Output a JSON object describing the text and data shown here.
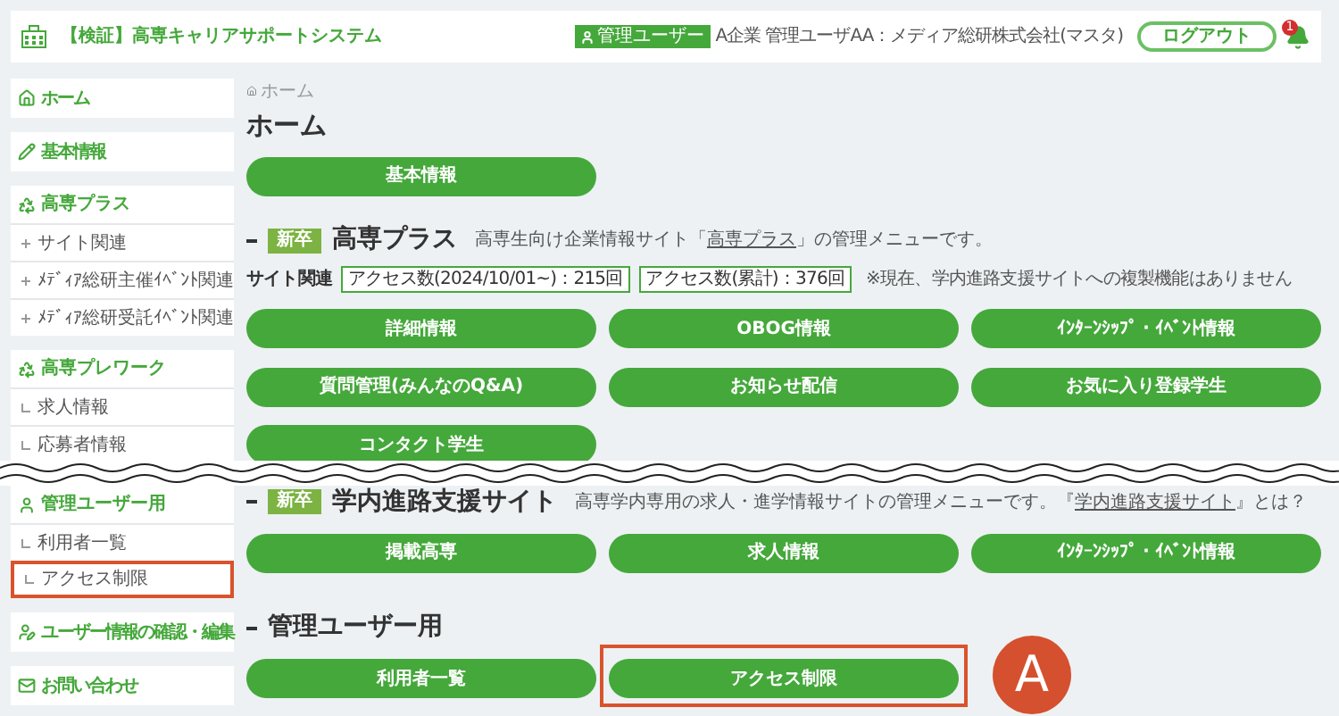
{
  "header": {
    "title": "【検証】高専キャリアサポートシステム",
    "role_badge": "管理ユーザー",
    "user": "A企業 管理ユーザAA：メディア総研株式会社(マスタ)",
    "logout": "ログアウト",
    "notification_count": "1"
  },
  "breadcrumb": "ホーム",
  "page_title": "ホーム",
  "top_buttons": [
    {
      "label": "基本情報",
      "highlighted": false
    }
  ],
  "before_cut": {
    "sidebar": [
      {
        "kind": "link",
        "label": "ホーム"
      },
      {
        "kind": "link",
        "label": "基本情報"
      },
      {
        "kind": "group",
        "label": "高専プラス",
        "plus_markers": true,
        "items": [
          {
            "label": "サイト関連",
            "highlighted": false
          },
          {
            "label": "ﾒﾃﾞｨｱ総研主催ｲﾍﾞﾝﾄ関連",
            "highlighted": false
          },
          {
            "label": "ﾒﾃﾞｨｱ総研受託ｲﾍﾞﾝﾄ関連",
            "highlighted": false
          }
        ]
      },
      {
        "kind": "group",
        "label": "高専プレワーク",
        "plus_markers": false,
        "items": [
          {
            "label": "求人情報",
            "highlighted": false
          },
          {
            "label": "応募者情報",
            "highlighted": false
          }
        ]
      }
    ],
    "sections": [
      {
        "badge": "新卒",
        "title": "高専プラス",
        "description": {
          "before": "高専生向け企業情報サイト「",
          "link": "高専プラス",
          "after": "」の管理メニューです。"
        },
        "subheading": "サイト関連",
        "stats": [
          "アクセス数(2024/10/01~)：215回",
          "アクセス数(累計)：376回"
        ],
        "note": "※現在、学内進路支援サイトへの複製機能はありません",
        "buttons": [
          {
            "label": "詳細情報",
            "highlighted": false
          },
          {
            "label": "OBOG情報",
            "highlighted": false
          },
          {
            "label": "ｲﾝﾀｰﾝｼｯﾌﾟ・ｲﾍﾞﾝﾄ情報",
            "highlighted": false
          },
          {
            "label": "質問管理(みんなのQ&A)",
            "highlighted": false
          },
          {
            "label": "お知らせ配信",
            "highlighted": false
          },
          {
            "label": "お気に入り登録学生",
            "highlighted": false
          },
          {
            "label": "コンタクト学生",
            "highlighted": false
          }
        ]
      }
    ]
  },
  "after_cut": {
    "sidebar": [
      {
        "kind": "group",
        "label": "管理ユーザー用",
        "plus_markers": false,
        "items": [
          {
            "label": "利用者一覧",
            "highlighted": false
          },
          {
            "label": "アクセス制限",
            "highlighted": true
          }
        ]
      },
      {
        "kind": "link",
        "label": "ユーザー情報の確認・編集"
      },
      {
        "kind": "link",
        "label": "お問い合わせ"
      }
    ],
    "sections": [
      {
        "badge": "新卒",
        "title": "学内進路支援サイト",
        "description": {
          "before": "高専学内専用の求人・進学情報サイトの管理メニューです。『",
          "link": "学内進路支援サイト",
          "after": "』とは？"
        },
        "buttons": [
          {
            "label": "掲載高専",
            "highlighted": false
          },
          {
            "label": "求人情報",
            "highlighted": false
          },
          {
            "label": "ｲﾝﾀｰﾝｼｯﾌﾟ・ｲﾍﾞﾝﾄ情報",
            "highlighted": false
          }
        ]
      },
      {
        "title": "管理ユーザー用",
        "callout": "A",
        "buttons": [
          {
            "label": "利用者一覧",
            "highlighted": false
          },
          {
            "label": "アクセス制限",
            "highlighted": true
          }
        ]
      }
    ]
  }
}
